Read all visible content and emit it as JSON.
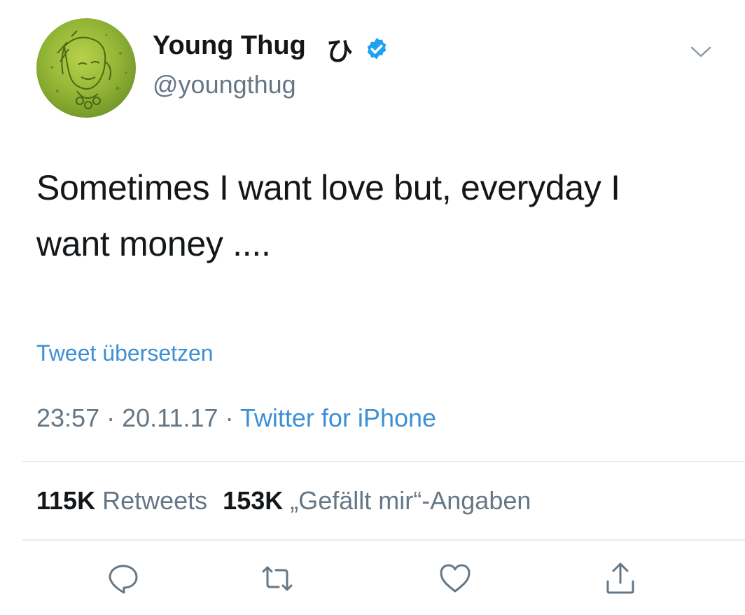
{
  "user": {
    "display_name": "Young Thug",
    "name_glyph": "ひ",
    "handle": "@youngthug",
    "verified": true
  },
  "tweet": {
    "text_line1": "Sometimes I want love but, everyday I",
    "text_line2": "want money ....",
    "translate_label": "Tweet übersetzen",
    "time": "23:57",
    "separator": " · ",
    "date": "20.11.17",
    "source": "Twitter for iPhone"
  },
  "stats": {
    "retweets_count": "115K",
    "retweets_label": "Retweets",
    "likes_count": "153K",
    "likes_label": "„Gefällt mir“-Angaben"
  },
  "icons": {
    "caret": "chevron-down-icon",
    "reply": "reply-icon",
    "retweet": "retweet-icon",
    "like": "heart-icon",
    "share": "share-icon",
    "verified": "verified-badge-icon"
  },
  "colors": {
    "text": "#14171a",
    "secondary": "#657786",
    "link": "#3d8fd6",
    "divider": "#e6ecf0",
    "verified": "#1da1f2"
  }
}
